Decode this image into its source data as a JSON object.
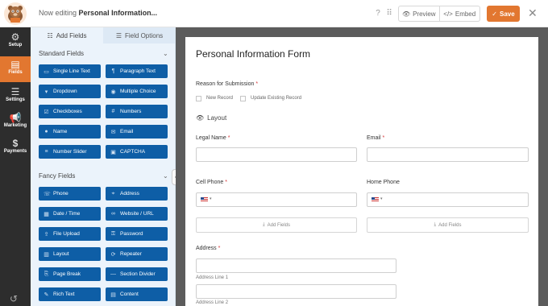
{
  "topbar": {
    "editing_prefix": "Now editing",
    "form_name": "Personal Information...",
    "preview_label": "Preview",
    "embed_label": "Embed",
    "save_label": "Save",
    "accent": "#e27730"
  },
  "rail": {
    "items": [
      {
        "label": "Setup",
        "icon": "gear-icon"
      },
      {
        "label": "Fields",
        "icon": "fields-icon"
      },
      {
        "label": "Settings",
        "icon": "sliders-icon"
      },
      {
        "label": "Marketing",
        "icon": "megaphone-icon"
      },
      {
        "label": "Payments",
        "icon": "dollar-icon"
      }
    ]
  },
  "panel": {
    "tabs": [
      {
        "label": "Add Fields"
      },
      {
        "label": "Field Options"
      }
    ],
    "standard_title": "Standard Fields",
    "fancy_title": "Fancy Fields",
    "standard": [
      {
        "label": "Single Line Text"
      },
      {
        "label": "Paragraph Text"
      },
      {
        "label": "Dropdown"
      },
      {
        "label": "Multiple Choice"
      },
      {
        "label": "Checkboxes"
      },
      {
        "label": "Numbers"
      },
      {
        "label": "Name"
      },
      {
        "label": "Email"
      },
      {
        "label": "Number Slider"
      },
      {
        "label": "CAPTCHA"
      }
    ],
    "fancy": [
      {
        "label": "Phone"
      },
      {
        "label": "Address"
      },
      {
        "label": "Date / Time"
      },
      {
        "label": "Website / URL"
      },
      {
        "label": "File Upload"
      },
      {
        "label": "Password"
      },
      {
        "label": "Layout"
      },
      {
        "label": "Repeater"
      },
      {
        "label": "Page Break"
      },
      {
        "label": "Section Divider"
      },
      {
        "label": "Rich Text"
      },
      {
        "label": "Content"
      }
    ],
    "button_color": "#0e5ea6"
  },
  "form": {
    "title": "Personal Information Form",
    "reason_label": "Reason for Submission",
    "option_new": "New Record",
    "option_update": "Update Existing Record",
    "layout_label": "Layout",
    "legal_name_label": "Legal Name",
    "email_label": "Email",
    "cell_phone_label": "Cell Phone",
    "home_phone_label": "Home Phone",
    "add_fields_label": "Add Fields",
    "address_label": "Address",
    "address_line1": "Address Line 1",
    "address_line2": "Address Line 2",
    "required_mark": "*"
  }
}
